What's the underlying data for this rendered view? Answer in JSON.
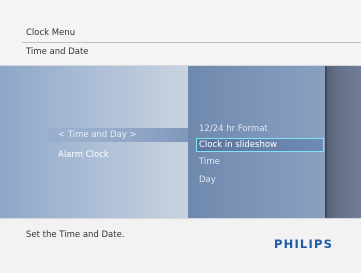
{
  "header": {
    "title": "Clock Menu",
    "breadcrumb": "Time and Date"
  },
  "menu": {
    "left_items": [
      {
        "label": "< Time and Day >",
        "selected": true
      },
      {
        "label": "Alarm Clock",
        "selected": false
      }
    ],
    "right_items": [
      {
        "label": "12/24 hr Format",
        "selected": false
      },
      {
        "label": "Clock in slideshow",
        "selected": true
      },
      {
        "label": "Time",
        "selected": false
      },
      {
        "label": "Day",
        "selected": false
      }
    ]
  },
  "footer": {
    "help_text": "Set the Time and Date.",
    "brand": "PHILIPS"
  },
  "colors": {
    "brand": "#1f5aa6",
    "selection_outline": "#7fe3f5",
    "menu_background": "#7a8599"
  }
}
